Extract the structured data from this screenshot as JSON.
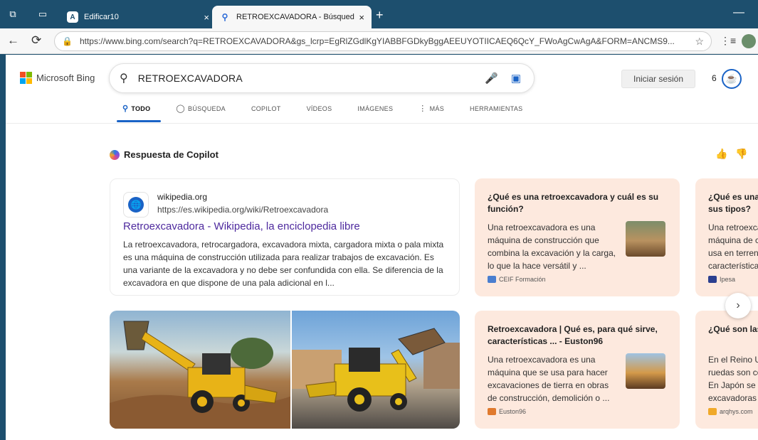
{
  "browser": {
    "tabs": [
      {
        "title": "Edificar10",
        "favicon_letter": "A",
        "active": false
      },
      {
        "title": "RETROEXCAVADORA - Búsqueda",
        "favicon_letter": "Q",
        "active": true
      }
    ],
    "url": "https://www.bing.com/search?q=RETROEXCAVADORA&gs_lcrp=EgRlZGdlKgYIABBFGDkyBggAEEUYOTIICAEQ6QcY_FWoAgCwAgA&FORM=ANCMS9...",
    "tab_close": "×",
    "new_tab": "+",
    "minimize": "—",
    "back": "←",
    "reload": "⟳",
    "star": "☆",
    "favorites": "⋮≡"
  },
  "header": {
    "logo_text": "Microsoft Bing",
    "brand_colors": [
      "#f25022",
      "#7fba00",
      "#00a4ef",
      "#ffb900"
    ],
    "search_query": "RETROEXCAVADORA",
    "signin_label": "Iniciar sesión",
    "rewards_count": "6"
  },
  "scopes": [
    {
      "label": "TODO",
      "icon": "search-icon",
      "active": true
    },
    {
      "label": "BÚSQUEDA",
      "icon": "copilot-search-icon",
      "active": false
    },
    {
      "label": "COPILOT",
      "icon": "",
      "active": false
    },
    {
      "label": "VÍDEOS",
      "icon": "",
      "active": false
    },
    {
      "label": "IMÁGENES",
      "icon": "",
      "active": false
    },
    {
      "label": "MÁS",
      "icon": "more-icon",
      "active": false
    },
    {
      "label": "HERRAMIENTAS",
      "icon": "",
      "active": false
    }
  ],
  "copilot": {
    "title": "Respuesta de Copilot",
    "wiki": {
      "domain": "wikipedia.org",
      "url": "https://es.wikipedia.org/wiki/Retroexcavadora",
      "title": "Retroexcavadora - Wikipedia, la enciclopedia libre",
      "snippet": "La retroexcavadora, retrocargadora, excavadora mixta, cargadora mixta o pala mixta es una máquina de construcción utilizada para realizar trabajos de excavación. Es una variante de la excavadora y no debe ser confundida con ella. Se diferencia de la excavadora en que dispone de una pala adicional en l..."
    },
    "cards": [
      {
        "question": "¿Qué es una retroexcavadora y cuál es su función?",
        "answer": "Una retroexcavadora es una máquina de construcción que combina la excavación y la carga, lo que la hace versátil y ...",
        "source": "CEIF Formación"
      },
      {
        "question": "¿Qué es una retroexcavadora y cuáles son sus tipos?",
        "answer": "Una retroexcavadora es una máquina de construcción que se usa en terrenos con sus características",
        "source": "Ipesa"
      },
      {
        "question": "Retroexcavadora | Qué es, para qué sirve, características ... - Euston96",
        "answer": "Una retroexcavadora es una máquina que se usa para hacer excavaciones de tierra en obras de construcción, demolición o ...",
        "source": "Euston96"
      },
      {
        "question": "¿Qué son las retroexcavadoras?",
        "answer": "En el Reino Unido las que tienen ruedas son conocidas como JCB. En Japón se las conoce como excavadoras",
        "source": "arqhys.com"
      }
    ]
  }
}
